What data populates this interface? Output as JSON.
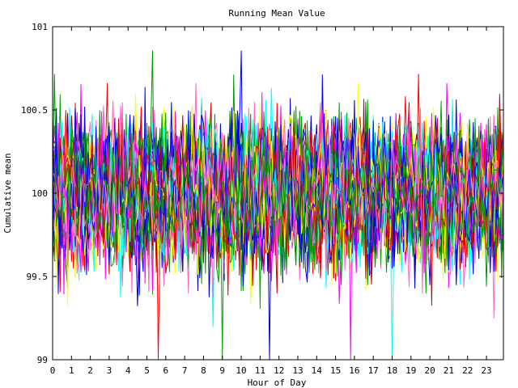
{
  "chart_data": {
    "type": "line",
    "title": "Running Mean Value",
    "xlabel": "Hour of Day",
    "ylabel": "Cumulative mean",
    "xlim": [
      0,
      23.9
    ],
    "ylim": [
      99,
      101
    ],
    "xticks": [
      0,
      1,
      2,
      3,
      4,
      5,
      6,
      7,
      8,
      9,
      10,
      11,
      12,
      13,
      14,
      15,
      16,
      17,
      18,
      19,
      20,
      21,
      22,
      23
    ],
    "yticks": [
      99,
      99.5,
      100,
      100.5,
      101
    ],
    "ytick_labels": [
      "99",
      "99.5",
      "100",
      "100.5",
      "101"
    ],
    "grid": false,
    "legend": "none",
    "x_resolution": 0.1,
    "series_count": 50,
    "series_colors": [
      "#ff0000",
      "#00aa00",
      "#0000cc",
      "#ff00ff",
      "#00ffff",
      "#ffff00",
      "#cc0000",
      "#0000ff",
      "#ff66cc",
      "#009900"
    ],
    "notes": "Dense overlay of noisy running-mean traces fluctuating around 100 (roughly 99.3 to 100.8); occasional spikes drop to 99 at x≈5.6, 9, 11.5, 15.8, 18."
  }
}
